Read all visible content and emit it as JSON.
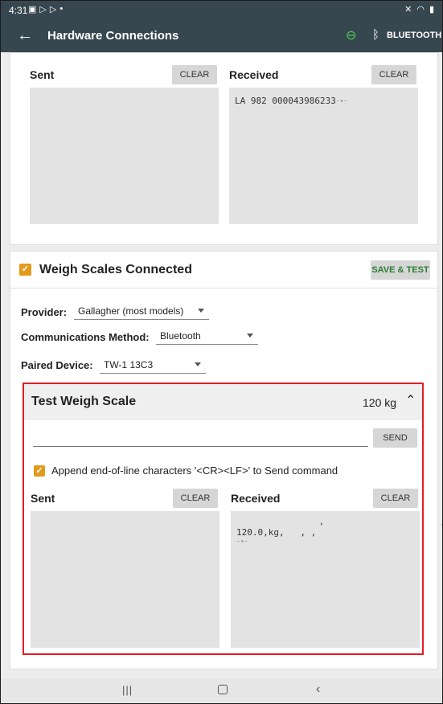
{
  "status_bar": {
    "time": "4:31"
  },
  "app_bar": {
    "title": "Hardware Connections",
    "bluetooth_label": "BLUETOOTH"
  },
  "top_card": {
    "sent_label": "Sent",
    "received_label": "Received",
    "clear_label": "CLEAR",
    "received_text": "LA 982 000043986233",
    "received_tail": "⁻ˢ⁻"
  },
  "scales": {
    "title": "Weigh Scales Connected",
    "save_label": "SAVE & TEST",
    "provider_label": "Provider:",
    "provider_value": "Gallagher (most models)",
    "comm_label": "Communications Method:",
    "comm_value": "Bluetooth",
    "device_label": "Paired Device:",
    "device_value": "TW-1 13C3"
  },
  "test_scale": {
    "title": "Test Weigh Scale",
    "weight": "120 kg",
    "send_label": "SEND",
    "command_value": "",
    "append_label": "Append end-of-line characters '<CR><LF>' to Send command",
    "sent_label": "Sent",
    "received_label": "Received",
    "clear_label": "CLEAR",
    "received_line1": ",                        ,",
    "received_line2": "120.0,kg,   , ,",
    "received_line3": "⁻ˢ⁻"
  },
  "colors": {
    "accent": "#e39a1c",
    "highlight": "#e41b23",
    "appbar": "#37474f",
    "link": "#4cd04c",
    "save": "#2e7d32"
  },
  "icons": [
    "back-arrow-icon",
    "link-icon",
    "bluetooth-icon",
    "chevron-up-icon",
    "checkbox-checked-icon",
    "recents-icon",
    "home-icon",
    "back-icon"
  ]
}
